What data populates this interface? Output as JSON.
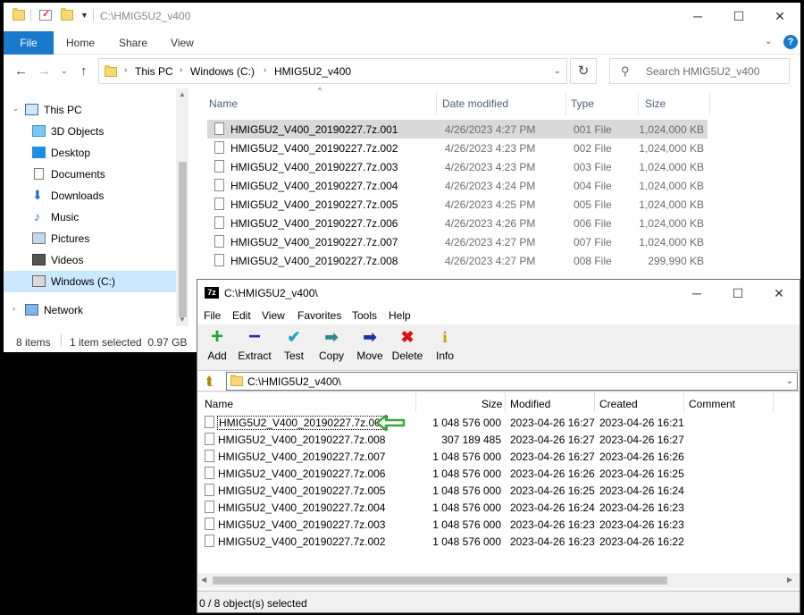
{
  "explorer": {
    "title": "C:\\HMIG5U2_v400",
    "ribbon": {
      "file": "File",
      "home": "Home",
      "share": "Share",
      "view": "View"
    },
    "breadcrumb": [
      "This PC",
      "Windows (C:)",
      "HMIG5U2_v400"
    ],
    "search_placeholder": "Search HMIG5U2_v400",
    "sidebar": [
      {
        "label": "This PC",
        "icon": "computer-icon"
      },
      {
        "label": "3D Objects",
        "icon": "cube-icon"
      },
      {
        "label": "Desktop",
        "icon": "desktop-icon"
      },
      {
        "label": "Documents",
        "icon": "document-icon"
      },
      {
        "label": "Downloads",
        "icon": "download-icon"
      },
      {
        "label": "Music",
        "icon": "music-icon"
      },
      {
        "label": "Pictures",
        "icon": "picture-icon"
      },
      {
        "label": "Videos",
        "icon": "video-icon"
      },
      {
        "label": "Windows (C:)",
        "icon": "drive-icon"
      },
      {
        "label": "Network",
        "icon": "network-icon"
      }
    ],
    "columns": {
      "name": "Name",
      "date": "Date modified",
      "type": "Type",
      "size": "Size"
    },
    "files": [
      {
        "name": "HMIG5U2_V400_20190227.7z.001",
        "date": "4/26/2023 4:27 PM",
        "type": "001 File",
        "size": "1,024,000 KB"
      },
      {
        "name": "HMIG5U2_V400_20190227.7z.002",
        "date": "4/26/2023 4:23 PM",
        "type": "002 File",
        "size": "1,024,000 KB"
      },
      {
        "name": "HMIG5U2_V400_20190227.7z.003",
        "date": "4/26/2023 4:23 PM",
        "type": "003 File",
        "size": "1,024,000 KB"
      },
      {
        "name": "HMIG5U2_V400_20190227.7z.004",
        "date": "4/26/2023 4:24 PM",
        "type": "004 File",
        "size": "1,024,000 KB"
      },
      {
        "name": "HMIG5U2_V400_20190227.7z.005",
        "date": "4/26/2023 4:25 PM",
        "type": "005 File",
        "size": "1,024,000 KB"
      },
      {
        "name": "HMIG5U2_V400_20190227.7z.006",
        "date": "4/26/2023 4:26 PM",
        "type": "006 File",
        "size": "1,024,000 KB"
      },
      {
        "name": "HMIG5U2_V400_20190227.7z.007",
        "date": "4/26/2023 4:27 PM",
        "type": "007 File",
        "size": "1,024,000 KB"
      },
      {
        "name": "HMIG5U2_V400_20190227.7z.008",
        "date": "4/26/2023 4:27 PM",
        "type": "008 File",
        "size": "299,990 KB"
      }
    ],
    "status": {
      "count": "8 items",
      "selected": "1 item selected  0.97 GB"
    }
  },
  "sevenzip": {
    "logo": "7z",
    "title": "C:\\HMIG5U2_v400\\",
    "menu": [
      "File",
      "Edit",
      "View",
      "Favorites",
      "Tools",
      "Help"
    ],
    "toolbar": [
      "Add",
      "Extract",
      "Test",
      "Copy",
      "Move",
      "Delete",
      "Info"
    ],
    "path": "C:\\HMIG5U2_v400\\",
    "columns": {
      "name": "Name",
      "size": "Size",
      "modified": "Modified",
      "created": "Created",
      "comment": "Comment"
    },
    "files": [
      {
        "name": "HMIG5U2_V400_20190227.7z.001",
        "size": "1 048 576 000",
        "modified": "2023-04-26 16:27",
        "created": "2023-04-26 16:21"
      },
      {
        "name": "HMIG5U2_V400_20190227.7z.008",
        "size": "307 189 485",
        "modified": "2023-04-26 16:27",
        "created": "2023-04-26 16:27"
      },
      {
        "name": "HMIG5U2_V400_20190227.7z.007",
        "size": "1 048 576 000",
        "modified": "2023-04-26 16:27",
        "created": "2023-04-26 16:26"
      },
      {
        "name": "HMIG5U2_V400_20190227.7z.006",
        "size": "1 048 576 000",
        "modified": "2023-04-26 16:26",
        "created": "2023-04-26 16:25"
      },
      {
        "name": "HMIG5U2_V400_20190227.7z.005",
        "size": "1 048 576 000",
        "modified": "2023-04-26 16:25",
        "created": "2023-04-26 16:24"
      },
      {
        "name": "HMIG5U2_V400_20190227.7z.004",
        "size": "1 048 576 000",
        "modified": "2023-04-26 16:24",
        "created": "2023-04-26 16:23"
      },
      {
        "name": "HMIG5U2_V400_20190227.7z.003",
        "size": "1 048 576 000",
        "modified": "2023-04-26 16:23",
        "created": "2023-04-26 16:23"
      },
      {
        "name": "HMIG5U2_V400_20190227.7z.002",
        "size": "1 048 576 000",
        "modified": "2023-04-26 16:23",
        "created": "2023-04-26 16:22"
      }
    ],
    "status": "0 / 8 object(s) selected"
  },
  "colors": {
    "accent": "#1979ca",
    "selection": "#cce8ff",
    "arrow": "#3aa53a"
  }
}
